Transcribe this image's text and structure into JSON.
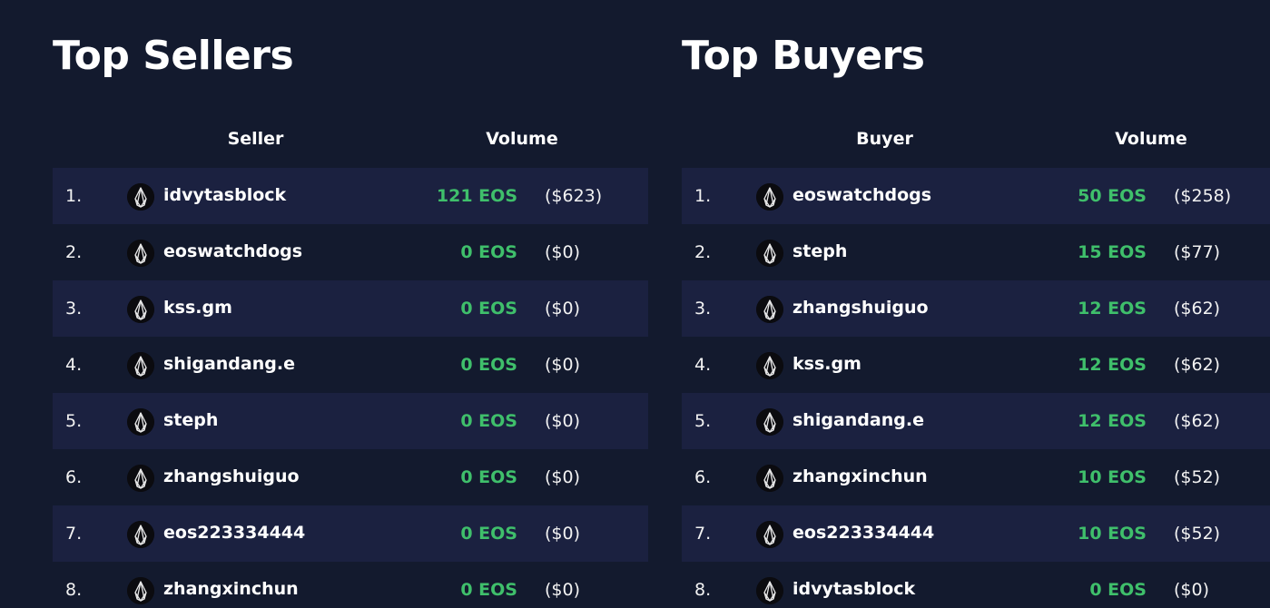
{
  "sellers": {
    "title": "Top Sellers",
    "col_name": "Seller",
    "col_volume": "Volume",
    "rows": [
      {
        "rank": "1.",
        "name": "idvytasblock",
        "eos": "121 EOS",
        "usd": "($623)"
      },
      {
        "rank": "2.",
        "name": "eoswatchdogs",
        "eos": "0 EOS",
        "usd": "($0)"
      },
      {
        "rank": "3.",
        "name": "kss.gm",
        "eos": "0 EOS",
        "usd": "($0)"
      },
      {
        "rank": "4.",
        "name": "shigandang.e",
        "eos": "0 EOS",
        "usd": "($0)"
      },
      {
        "rank": "5.",
        "name": "steph",
        "eos": "0 EOS",
        "usd": "($0)"
      },
      {
        "rank": "6.",
        "name": "zhangshuiguo",
        "eos": "0 EOS",
        "usd": "($0)"
      },
      {
        "rank": "7.",
        "name": "eos223334444",
        "eos": "0 EOS",
        "usd": "($0)"
      },
      {
        "rank": "8.",
        "name": "zhangxinchun",
        "eos": "0 EOS",
        "usd": "($0)"
      }
    ]
  },
  "buyers": {
    "title": "Top Buyers",
    "col_name": "Buyer",
    "col_volume": "Volume",
    "rows": [
      {
        "rank": "1.",
        "name": "eoswatchdogs",
        "eos": "50 EOS",
        "usd": "($258)"
      },
      {
        "rank": "2.",
        "name": "steph",
        "eos": "15 EOS",
        "usd": "($77)"
      },
      {
        "rank": "3.",
        "name": "zhangshuiguo",
        "eos": "12 EOS",
        "usd": "($62)"
      },
      {
        "rank": "4.",
        "name": "kss.gm",
        "eos": "12 EOS",
        "usd": "($62)"
      },
      {
        "rank": "5.",
        "name": "shigandang.e",
        "eos": "12 EOS",
        "usd": "($62)"
      },
      {
        "rank": "6.",
        "name": "zhangxinchun",
        "eos": "10 EOS",
        "usd": "($52)"
      },
      {
        "rank": "7.",
        "name": "eos223334444",
        "eos": "10 EOS",
        "usd": "($52)"
      },
      {
        "rank": "8.",
        "name": "idvytasblock",
        "eos": "0 EOS",
        "usd": "($0)"
      }
    ]
  },
  "avatar_icon": "eos-logo-icon",
  "colors": {
    "background": "#131a2e",
    "row_alt": "#1b2140",
    "volume_green": "#3fbf6b",
    "text": "#ffffff"
  }
}
